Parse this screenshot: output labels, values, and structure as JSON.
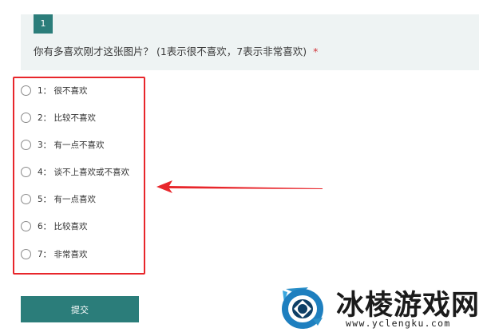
{
  "question": {
    "number": "1",
    "title": "你有多喜欢刚才这张图片？ (1表示很不喜欢，7表示非常喜欢)",
    "required_mark": "*"
  },
  "options": [
    {
      "label": "1： 很不喜欢"
    },
    {
      "label": "2： 比较不喜欢"
    },
    {
      "label": "3： 有一点不喜欢"
    },
    {
      "label": "4： 谈不上喜欢或不喜欢"
    },
    {
      "label": "5： 有一点喜欢"
    },
    {
      "label": "6： 比较喜欢"
    },
    {
      "label": "7： 非常喜欢"
    }
  ],
  "submit_label": "提交",
  "watermark": {
    "name": "冰棱游戏网",
    "url": "www.yclengku.com"
  },
  "colors": {
    "accent": "#2b7d7a",
    "card_background": "#eef3f3",
    "highlight": "#e8262b",
    "required": "#d13438"
  },
  "icons": {
    "annotation": "red-arrow-left-icon",
    "logo": "watermark-logo-icon"
  }
}
